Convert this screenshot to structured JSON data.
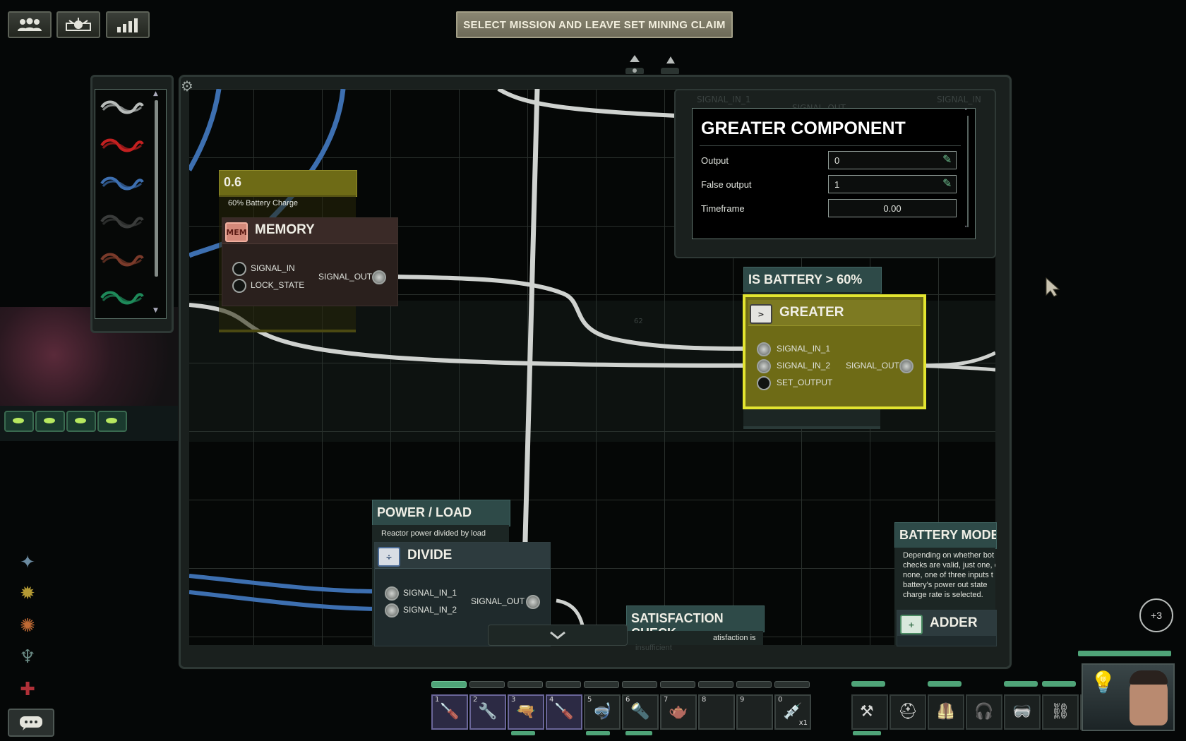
{
  "top_buttons": [
    {
      "icon": "crew-icon"
    },
    {
      "icon": "mission-icon"
    },
    {
      "icon": "stats-icon"
    }
  ],
  "mission_banner": "SELECT MISSION AND LEAVE SET MINING CLAIM",
  "wires": [
    {
      "color": "#b8bcba",
      "name": "white"
    },
    {
      "color": "#c32020",
      "name": "red"
    },
    {
      "color": "#3d6fb0",
      "name": "blue"
    },
    {
      "color": "#3a3c3b",
      "name": "black"
    },
    {
      "color": "#7a3a2a",
      "name": "brown"
    },
    {
      "color": "#1e8a5a",
      "name": "green"
    }
  ],
  "ghost_labels": {
    "signal_in_1": "SIGNAL_IN_1",
    "signal_out": "SIGNAL_OUT",
    "signal_in": "SIGNAL_IN",
    "grid_number": "62"
  },
  "memory_node": {
    "value_label": "0.6",
    "description": "60% Battery Charge",
    "title": "MEMORY",
    "icon_text": "MEM",
    "inputs": [
      "SIGNAL_IN",
      "LOCK_STATE"
    ],
    "output": "SIGNAL_OUT"
  },
  "greater_component_panel": {
    "title": "GREATER COMPONENT",
    "fields": [
      {
        "label": "Output",
        "value": "0"
      },
      {
        "label": "False output",
        "value": "1"
      },
      {
        "label": "Timeframe",
        "value": "0.00"
      }
    ]
  },
  "greater_node": {
    "label": "IS BATTERY > 60%",
    "title": "GREATER",
    "inputs": [
      "SIGNAL_IN_1",
      "SIGNAL_IN_2",
      "SET_OUTPUT"
    ],
    "output": "SIGNAL_OUT"
  },
  "divide_node": {
    "label": "POWER / LOAD",
    "description": "Reactor power divided by load",
    "title": "DIVIDE",
    "inputs": [
      "SIGNAL_IN_1",
      "SIGNAL_IN_2"
    ],
    "output": "SIGNAL_OUT"
  },
  "satisfaction_node": {
    "label": "SATISFACTION CHECK",
    "description": "atisfaction is",
    "description2": "insufficient"
  },
  "battery_node": {
    "label": "BATTERY MODE DEC",
    "description": [
      "Depending on whether bot",
      "checks are valid, just one, o",
      "none, one of three inputs t",
      "battery's power out state",
      "charge rate is selected."
    ],
    "title": "ADDER"
  },
  "notification_badge": "+3",
  "hotbar": [
    {
      "num": "1",
      "item": "screwdriver-icon",
      "selected": true
    },
    {
      "num": "2",
      "item": "wrench-icon",
      "selected": true
    },
    {
      "num": "3",
      "item": "gun-icon",
      "selected": true
    },
    {
      "num": "4",
      "item": "screwdriver-icon",
      "selected": true
    },
    {
      "num": "5",
      "item": "diving-mask-icon",
      "selected": false
    },
    {
      "num": "6",
      "item": "flashlight-icon",
      "selected": false
    },
    {
      "num": "7",
      "item": "watering-can-icon",
      "selected": false
    },
    {
      "num": "8",
      "item": "",
      "selected": false
    },
    {
      "num": "9",
      "item": "",
      "selected": false
    },
    {
      "num": "0",
      "item": "syringe-icon",
      "selected": false,
      "count": "x1"
    }
  ],
  "equipment": [
    {
      "item": "harpoon-icon"
    },
    {
      "item": "helmet-icon"
    },
    {
      "item": "vest-icon"
    },
    {
      "item": "headset-icon"
    },
    {
      "item": "goggles-icon"
    },
    {
      "item": "handcuffs-icon"
    },
    {
      "item": "id-card-icon"
    }
  ],
  "side_icons": [
    "skill-icon-1",
    "skill-icon-2",
    "skill-icon-3",
    "skill-icon-4",
    "skill-icon-5"
  ],
  "colors": {
    "accent_yellow": "#c8c928",
    "node_yellow": "#6e6b16",
    "panel_teal": "#2e4a48",
    "wire_blue": "#3d6fb0",
    "wire_gray": "#cfd2cf"
  }
}
